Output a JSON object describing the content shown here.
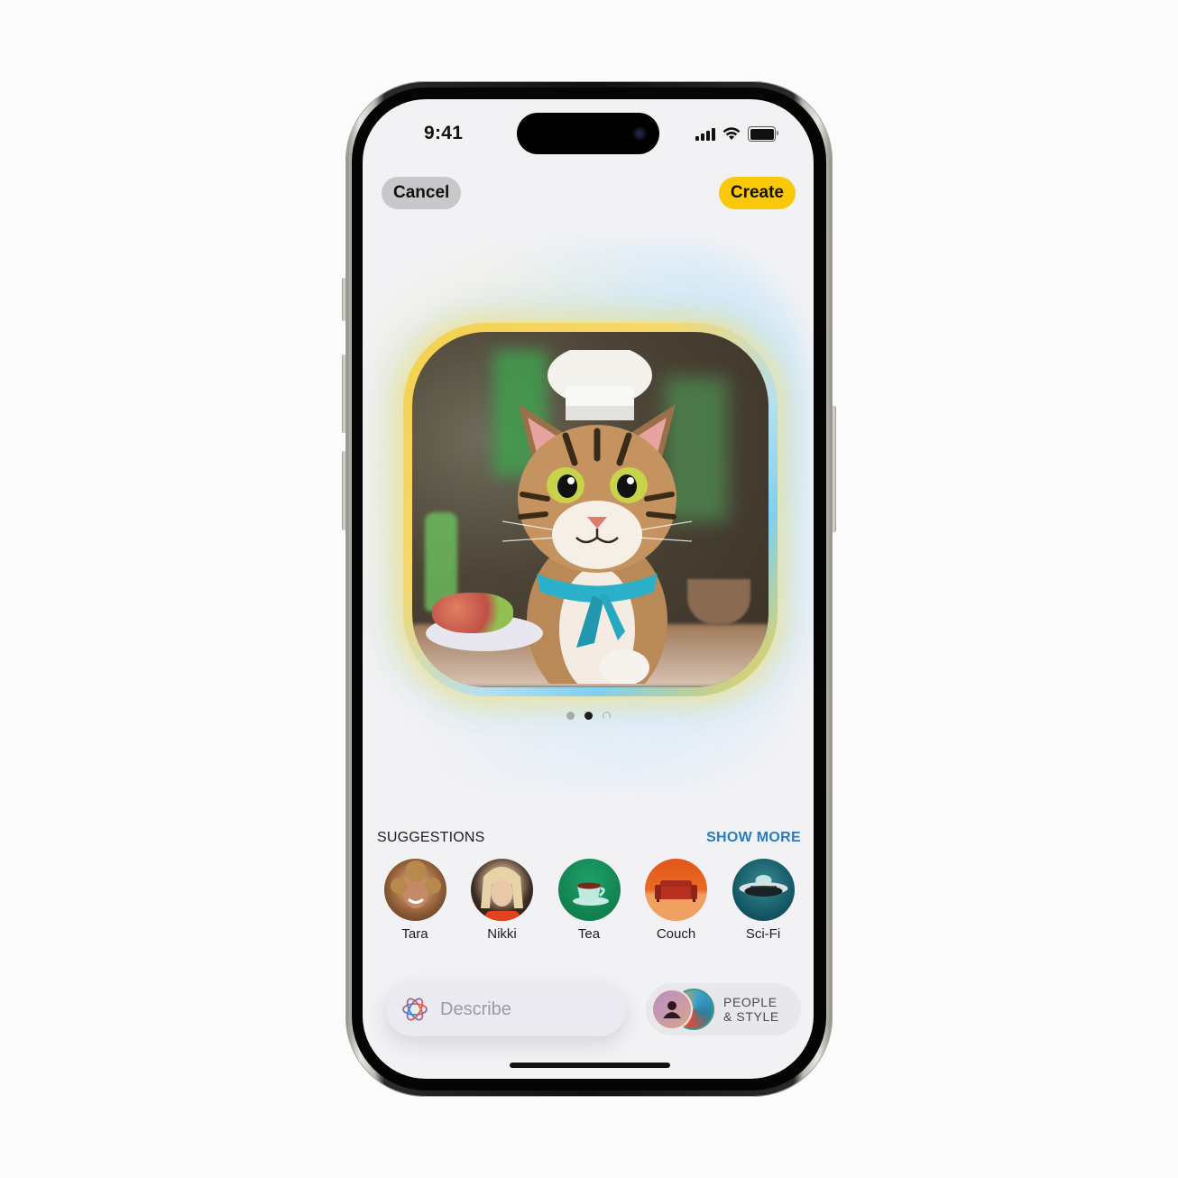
{
  "status_bar": {
    "time": "9:41",
    "icons": [
      "cellular-signal-icon",
      "wifi-icon",
      "battery-icon"
    ]
  },
  "nav": {
    "cancel_label": "Cancel",
    "create_label": "Create"
  },
  "preview": {
    "image_description": "Cartoon tabby cat wearing a white chef hat and teal neckerchief, sitting at a table with a plate of food",
    "page_count": 3,
    "current_page": 2,
    "pages": [
      "inactive",
      "active",
      "loading"
    ]
  },
  "suggestions": {
    "title": "SUGGESTIONS",
    "show_more_label": "SHOW MORE",
    "items": [
      {
        "label": "Tara",
        "kind": "person"
      },
      {
        "label": "Nikki",
        "kind": "person"
      },
      {
        "label": "Tea",
        "kind": "concept"
      },
      {
        "label": "Couch",
        "kind": "concept"
      },
      {
        "label": "Sci-Fi",
        "kind": "theme"
      }
    ]
  },
  "describe": {
    "placeholder": "Describe",
    "value": ""
  },
  "people_style": {
    "line1": "PEOPLE",
    "line2": "& STYLE"
  },
  "colors": {
    "create_accent": "#f9c808",
    "cancel_bg": "#c8c8cb",
    "show_more": "#2a7bbf",
    "screen_bg": "#f2f2f5"
  }
}
